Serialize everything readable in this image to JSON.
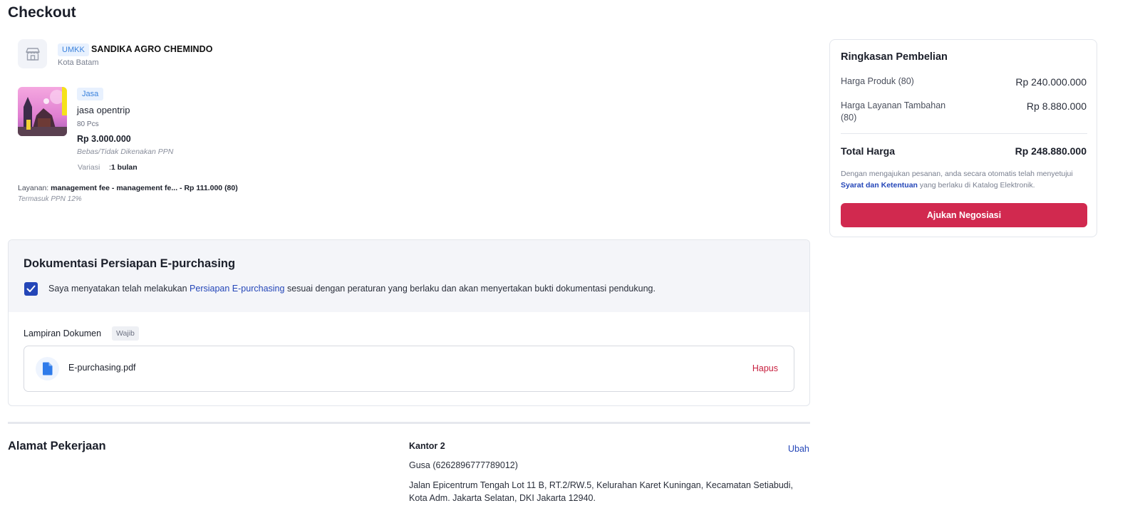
{
  "page": {
    "title": "Checkout"
  },
  "seller": {
    "badge": "UMKK",
    "name": "SANDIKA AGRO CHEMINDO",
    "city": "Kota Batam"
  },
  "product": {
    "type_badge": "Jasa",
    "name": "jasa opentrip",
    "quantity": "80 Pcs",
    "price": "Rp 3.000.000",
    "tax_note": "Bebas/Tidak Dikenakan PPN",
    "variant_label": "Variasi",
    "variant_separator": ":",
    "variant_value": "1 bulan",
    "service_label": "Layanan:",
    "service_value": "management fee - management fe... - Rp 111.000 (80)",
    "service_tax_note": "Termasuk PPN 12%"
  },
  "documentation": {
    "title": "Dokumentasi Persiapan E-purchasing",
    "checked": true,
    "statement_before": "Saya menyatakan telah melakukan ",
    "statement_link": "Persiapan E-purchasing",
    "statement_after": " sesuai dengan peraturan yang berlaku dan akan menyertakan bukti dokumentasi pendukung.",
    "attachment_label": "Lampiran Dokumen",
    "required_badge": "Wajib",
    "file_name": "E-purchasing.pdf",
    "delete_label": "Hapus"
  },
  "address": {
    "title": "Alamat Pekerjaan",
    "name": "Kantor 2",
    "change_label": "Ubah",
    "contact": "Gusa (6262896777789012)",
    "line": "Jalan Epicentrum Tengah Lot 11 B, RT.2/RW.5, Kelurahan Karet Kuningan, Kecamatan Setiabudi, Kota Adm. Jakarta Selatan, DKI Jakarta 12940."
  },
  "summary": {
    "title": "Ringkasan Pembelian",
    "product_price_label": "Harga Produk (80)",
    "product_price_value": "Rp 240.000.000",
    "service_price_label": "Harga Layanan Tambahan (80)",
    "service_price_value": "Rp 8.880.000",
    "total_label": "Total Harga",
    "total_value": "Rp 248.880.000",
    "terms_before": "Dengan mengajukan pesanan, anda secara otomatis telah menyetujui ",
    "terms_link": "Syarat dan Ketentuan",
    "terms_after": " yang berlaku di Katalog Elektronik.",
    "button_label": "Ajukan Negosiasi"
  },
  "colors": {
    "primary_button": "#d1294f",
    "link": "#2446b8",
    "delete": "#c8203f",
    "badge_bg": "#e8f1fe",
    "badge_text": "#3b82dc"
  },
  "icons": {
    "store": "store-icon",
    "checkbox": "check-icon",
    "file": "file-icon"
  }
}
